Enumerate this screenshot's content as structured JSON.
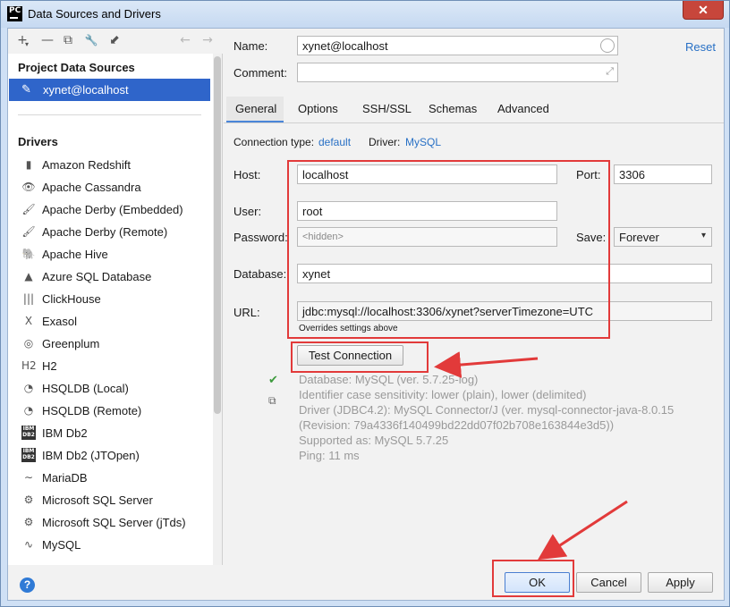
{
  "window": {
    "title": "Data Sources and Drivers",
    "app_icon_label": "PC",
    "close_symbol": "✕"
  },
  "left": {
    "toolbar": {
      "add": "+",
      "add_caret": "▾",
      "remove": "—",
      "duplicate": "⧉",
      "settings": "🔧",
      "import": "⬋",
      "back": "←",
      "forward": "→"
    },
    "project_title": "Project Data Sources",
    "datasource": {
      "icon": "✎",
      "label": "xynet@localhost"
    },
    "drivers_title": "Drivers",
    "drivers": [
      {
        "icon": "▮",
        "label": "Amazon Redshift"
      },
      {
        "icon": "👁",
        "label": "Apache Cassandra"
      },
      {
        "icon": "🖌",
        "label": "Apache Derby (Embedded)"
      },
      {
        "icon": "🖌",
        "label": "Apache Derby (Remote)"
      },
      {
        "icon": "🐘",
        "label": "Apache Hive"
      },
      {
        "icon": "▲",
        "label": "Azure SQL Database"
      },
      {
        "icon": "|||",
        "label": "ClickHouse"
      },
      {
        "icon": "X",
        "label": "Exasol"
      },
      {
        "icon": "◎",
        "label": "Greenplum"
      },
      {
        "icon": "H2",
        "label": "H2"
      },
      {
        "icon": "◔",
        "label": "HSQLDB (Local)"
      },
      {
        "icon": "◔",
        "label": "HSQLDB (Remote)"
      },
      {
        "icon": "IBM DB2",
        "label": "IBM Db2"
      },
      {
        "icon": "IBM DB2",
        "label": "IBM Db2 (JTOpen)"
      },
      {
        "icon": "∼",
        "label": "MariaDB"
      },
      {
        "icon": "⚙",
        "label": "Microsoft SQL Server"
      },
      {
        "icon": "⚙",
        "label": "Microsoft SQL Server (jTds)"
      },
      {
        "icon": "∿",
        "label": "MySQL"
      }
    ]
  },
  "right": {
    "name_label": "Name:",
    "name_value": "xynet@localhost",
    "comment_label": "Comment:",
    "comment_expand": "⤢",
    "reset": "Reset",
    "tabs": [
      "General",
      "Options",
      "SSH/SSL",
      "Schemas",
      "Advanced"
    ],
    "connection_type_label": "Connection type:",
    "connection_type_value": "default",
    "driver_label": "Driver:",
    "driver_value": "MySQL",
    "host_label": "Host:",
    "host_value": "localhost",
    "port_label": "Port:",
    "port_value": "3306",
    "user_label": "User:",
    "user_value": "root",
    "password_label": "Password:",
    "password_placeholder": "<hidden>",
    "save_label": "Save:",
    "save_value": "Forever",
    "database_label": "Database:",
    "database_value": "xynet",
    "url_label": "URL:",
    "url_value": "jdbc:mysql://localhost:3306/xynet?serverTimezone=UTC",
    "url_hint": "Overrides settings above",
    "test_button": "Test Connection",
    "info": [
      "Database: MySQL (ver. 5.7.25-log)",
      "Identifier case sensitivity: lower (plain), lower (delimited)",
      "Driver (JDBC4.2): MySQL Connector/J (ver. mysql-connector-java-8.0.15",
      "(Revision: 79a4336f140499bd22dd07f02b708e163844e3d5))",
      "Supported as: MySQL 5.7.25",
      "Ping: 11 ms"
    ]
  },
  "footer": {
    "help": "?",
    "ok": "OK",
    "cancel": "Cancel",
    "apply": "Apply"
  },
  "colors": {
    "selection": "#2f65ca",
    "link": "#2870c5",
    "annotation": "#e23a3a"
  }
}
